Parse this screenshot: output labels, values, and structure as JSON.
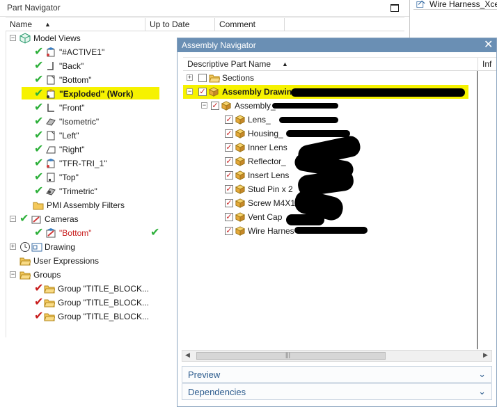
{
  "top_right": {
    "title": "Wire Harness_Xcer"
  },
  "part_navigator": {
    "title": "Part Navigator",
    "columns": [
      "Name",
      "Up to Date",
      "Comment"
    ],
    "rows": [
      {
        "label": "Model Views",
        "indent": 0
      },
      {
        "label": "\"#ACTIVE1\"",
        "indent": 1
      },
      {
        "label": "\"Back\"",
        "indent": 1
      },
      {
        "label": "\"Bottom\"",
        "indent": 1
      },
      {
        "label": "\"Exploded\" (Work)",
        "indent": 1,
        "bold": true,
        "highlight": true
      },
      {
        "label": "\"Front\"",
        "indent": 1
      },
      {
        "label": "\"Isometric\"",
        "indent": 1
      },
      {
        "label": "\"Left\"",
        "indent": 1
      },
      {
        "label": "\"Right\"",
        "indent": 1
      },
      {
        "label": "\"TFR-TRI_1\"",
        "indent": 1
      },
      {
        "label": "\"Top\"",
        "indent": 1
      },
      {
        "label": "\"Trimetric\"",
        "indent": 1
      },
      {
        "label": "PMI Assembly Filters",
        "indent": 1
      },
      {
        "label": "Cameras",
        "indent": 0
      },
      {
        "label": "\"Bottom\"",
        "indent": 1,
        "red": true,
        "up_to_date": "✔"
      },
      {
        "label": "Drawing",
        "indent": 0
      },
      {
        "label": "User Expressions",
        "indent": 0
      },
      {
        "label": "Groups",
        "indent": 0
      },
      {
        "label": "Group \"TITLE_BLOCK...",
        "indent": 1
      },
      {
        "label": "Group \"TITLE_BLOCK...",
        "indent": 1
      },
      {
        "label": "Group \"TITLE_BLOCK...",
        "indent": 1
      }
    ]
  },
  "assembly_navigator": {
    "title": "Assembly Navigator",
    "close_icon": "✕",
    "columns": [
      "Descriptive Part Name",
      "Inf"
    ],
    "rows": [
      {
        "label": "Sections",
        "indent": 0
      },
      {
        "label": "Assembly Drawing_",
        "indent": 0,
        "bold": true,
        "highlight": true
      },
      {
        "label": "Assembly_",
        "indent": 1
      },
      {
        "label": "Lens_",
        "indent": 2
      },
      {
        "label": "Housing_",
        "indent": 2
      },
      {
        "label": "Inner Lens",
        "indent": 2
      },
      {
        "label": "Reflector_",
        "indent": 2
      },
      {
        "label": "Insert Lens",
        "indent": 2
      },
      {
        "label": "Stud Pin x 2",
        "indent": 2
      },
      {
        "label": "Screw M4X12",
        "indent": 2
      },
      {
        "label": "Vent Cap",
        "indent": 2
      },
      {
        "label": "Wire Harnes",
        "indent": 2
      }
    ],
    "panels": [
      "Preview",
      "Dependencies"
    ]
  }
}
